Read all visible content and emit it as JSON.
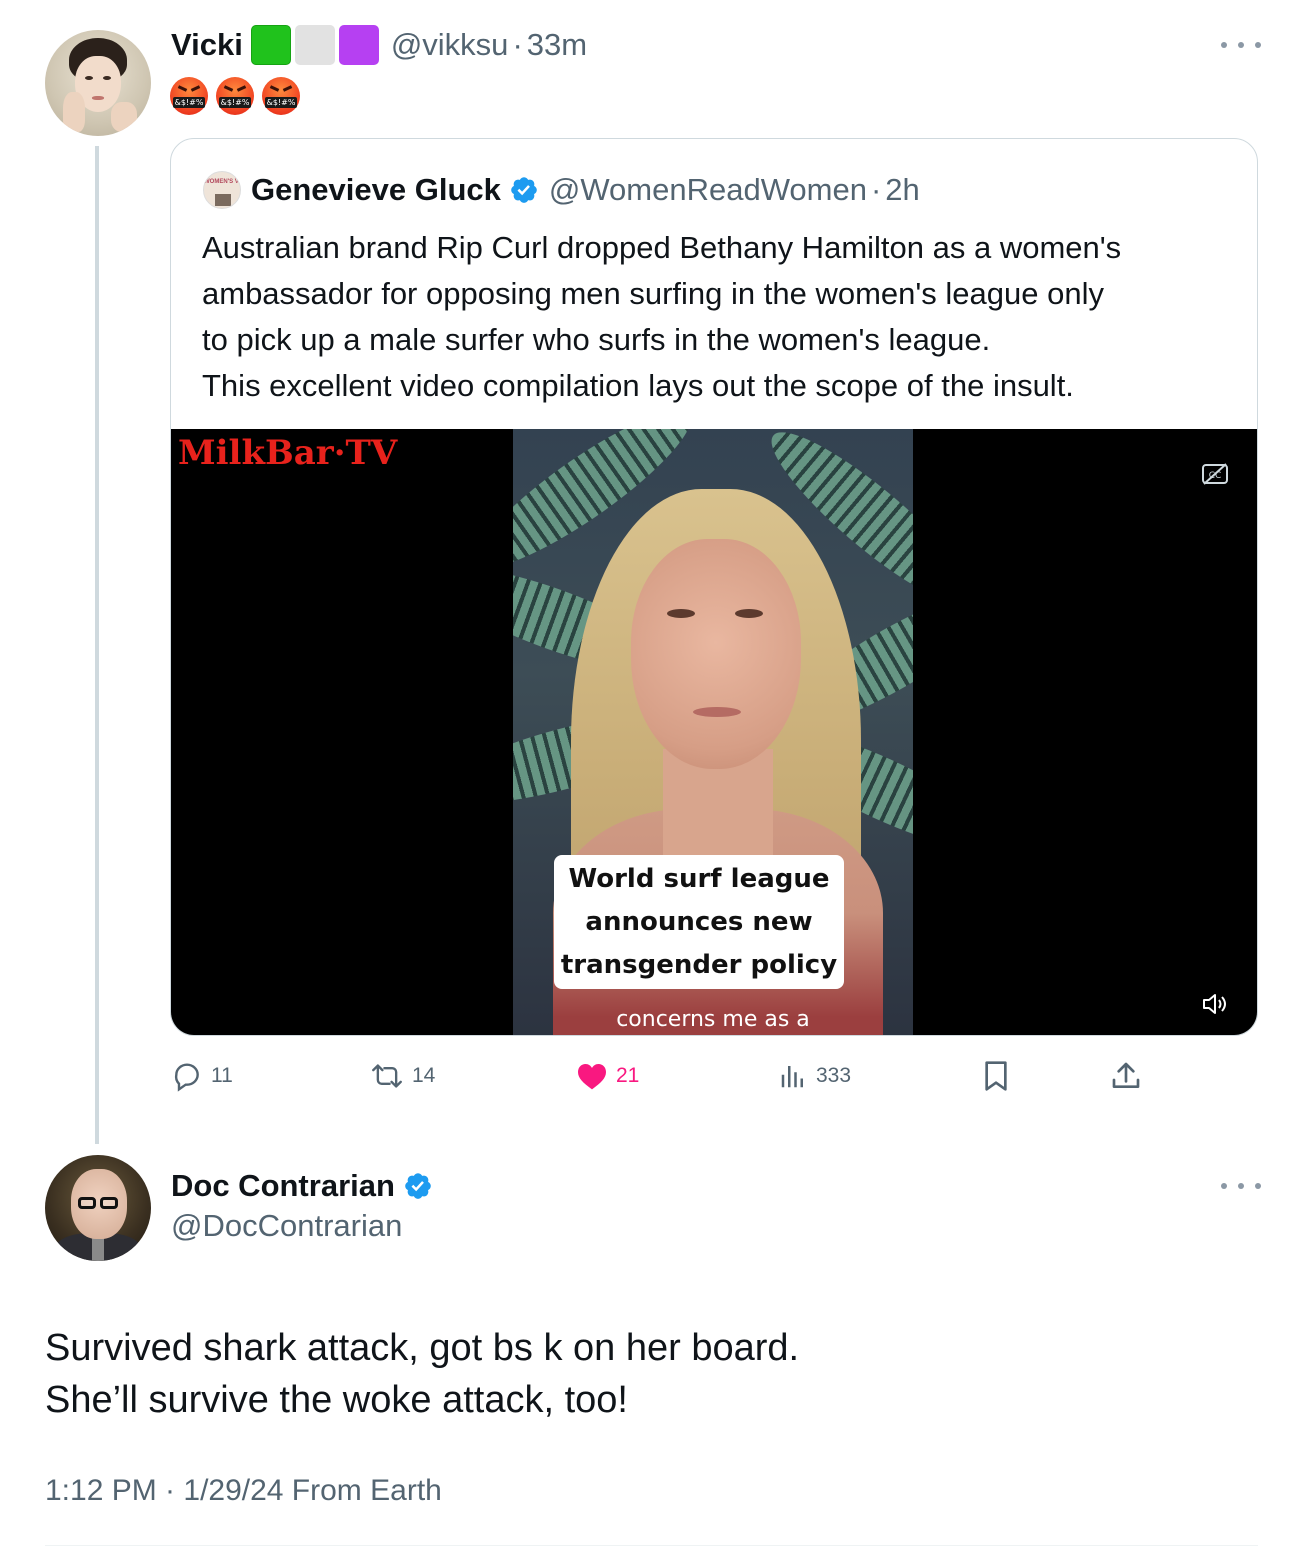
{
  "tweet1": {
    "display_name": "Vicki",
    "handle": "@vikksu",
    "separator": "·",
    "time": "33m",
    "emoji_flags": [
      "green-square",
      "grey-square",
      "purple-square"
    ],
    "body_emoji": [
      "angry-symbols-face",
      "angry-symbols-face",
      "angry-symbols-face"
    ],
    "emoji_symbol_text": "&$!#%"
  },
  "quote": {
    "display_name": "Genevieve Gluck",
    "verified": true,
    "handle": "@WomenReadWomen",
    "separator": "·",
    "time": "2h",
    "avatar_label": "WOMEN'S VOICES",
    "text_lines": [
      "Australian brand Rip Curl dropped Bethany Hamilton as a women's",
      "ambassador for opposing men surfing in the women's league only",
      "to pick up a male surfer who surfs in the women's league.",
      "This excellent video compilation lays out the scope of the insult."
    ],
    "video": {
      "watermark": "MilkBar·TV",
      "caption_lines": [
        "World surf league",
        "announces new",
        "transgender policy"
      ],
      "subtitle_partial": "concerns me as a",
      "icons": [
        "closed-captions-off-icon",
        "volume-icon"
      ]
    }
  },
  "actions": {
    "replies": "11",
    "reposts": "14",
    "likes": "21",
    "views": "333",
    "liked": true
  },
  "tweet2": {
    "display_name": "Doc Contrarian",
    "verified": true,
    "handle": "@DocContrarian",
    "text_lines": [
      "Survived shark attack, got bs k on her board.",
      "She’ll survive the woke attack, too!"
    ],
    "meta": "1:12 PM · 1/29/24 From Earth"
  },
  "colors": {
    "accent_blue": "#1d9bf0",
    "like_pink": "#f91880",
    "muted_text": "#536471",
    "border": "#cfd9de"
  }
}
